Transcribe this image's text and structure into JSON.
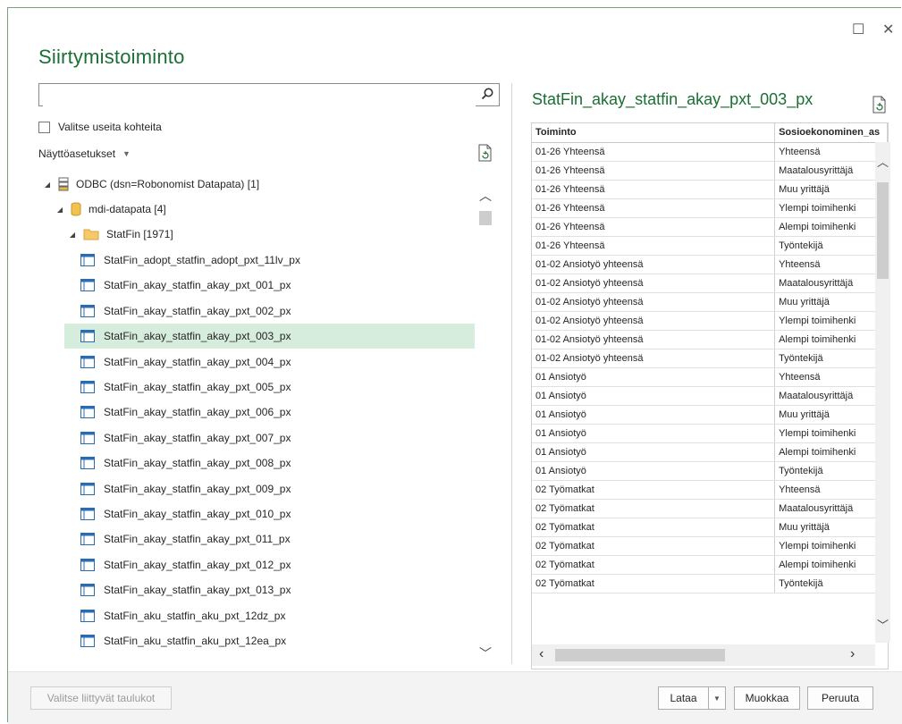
{
  "window": {
    "title": "Siirtymistoiminto",
    "maximize_glyph": "☐",
    "close_glyph": "✕"
  },
  "left": {
    "search": {
      "value": "",
      "placeholder": ""
    },
    "select_multiple_label": "Valitse useita kohteita",
    "view_options_label": "Näyttöasetukset",
    "tree": {
      "root": "ODBC (dsn=Robonomist Datapata) [1]",
      "database": "mdi-datapata [4]",
      "folder": "StatFin [1971]",
      "tables": [
        "StatFin_adopt_statfin_adopt_pxt_11lv_px",
        "StatFin_akay_statfin_akay_pxt_001_px",
        "StatFin_akay_statfin_akay_pxt_002_px",
        "StatFin_akay_statfin_akay_pxt_003_px",
        "StatFin_akay_statfin_akay_pxt_004_px",
        "StatFin_akay_statfin_akay_pxt_005_px",
        "StatFin_akay_statfin_akay_pxt_006_px",
        "StatFin_akay_statfin_akay_pxt_007_px",
        "StatFin_akay_statfin_akay_pxt_008_px",
        "StatFin_akay_statfin_akay_pxt_009_px",
        "StatFin_akay_statfin_akay_pxt_010_px",
        "StatFin_akay_statfin_akay_pxt_011_px",
        "StatFin_akay_statfin_akay_pxt_012_px",
        "StatFin_akay_statfin_akay_pxt_013_px",
        "StatFin_aku_statfin_aku_pxt_12dz_px",
        "StatFin_aku_statfin_aku_pxt_12ea_px"
      ],
      "selected_index": 3
    }
  },
  "right": {
    "title": "StatFin_akay_statfin_akay_pxt_003_px",
    "columns": [
      "Toiminto",
      "Sosioekonominen_as"
    ],
    "rows": [
      [
        "01-26 Yhteensä",
        "Yhteensä"
      ],
      [
        "01-26 Yhteensä",
        "Maatalousyrittäjä"
      ],
      [
        "01-26 Yhteensä",
        "Muu yrittäjä"
      ],
      [
        "01-26 Yhteensä",
        "Ylempi toimihenki"
      ],
      [
        "01-26 Yhteensä",
        "Alempi toimihenki"
      ],
      [
        "01-26 Yhteensä",
        "Työntekijä"
      ],
      [
        "01-02 Ansiotyö yhteensä",
        "Yhteensä"
      ],
      [
        "01-02 Ansiotyö yhteensä",
        "Maatalousyrittäjä"
      ],
      [
        "01-02 Ansiotyö yhteensä",
        "Muu yrittäjä"
      ],
      [
        "01-02 Ansiotyö yhteensä",
        "Ylempi toimihenki"
      ],
      [
        "01-02 Ansiotyö yhteensä",
        "Alempi toimihenki"
      ],
      [
        "01-02 Ansiotyö yhteensä",
        "Työntekijä"
      ],
      [
        "01 Ansiotyö",
        "Yhteensä"
      ],
      [
        "01 Ansiotyö",
        "Maatalousyrittäjä"
      ],
      [
        "01 Ansiotyö",
        "Muu yrittäjä"
      ],
      [
        "01 Ansiotyö",
        "Ylempi toimihenki"
      ],
      [
        "01 Ansiotyö",
        "Alempi toimihenki"
      ],
      [
        "01 Ansiotyö",
        "Työntekijä"
      ],
      [
        "02 Työmatkat",
        "Yhteensä"
      ],
      [
        "02 Työmatkat",
        "Maatalousyrittäjä"
      ],
      [
        "02 Työmatkat",
        "Muu yrittäjä"
      ],
      [
        "02 Työmatkat",
        "Ylempi toimihenki"
      ],
      [
        "02 Työmatkat",
        "Alempi toimihenki"
      ],
      [
        "02 Työmatkat",
        "Työntekijä"
      ]
    ]
  },
  "footer": {
    "related_tables_label": "Valitse liittyvät taulukot",
    "load_label": "Lataa",
    "edit_label": "Muokkaa",
    "cancel_label": "Peruuta"
  },
  "colors": {
    "accent": "#1b6e34",
    "selection": "#d6ecdc"
  }
}
